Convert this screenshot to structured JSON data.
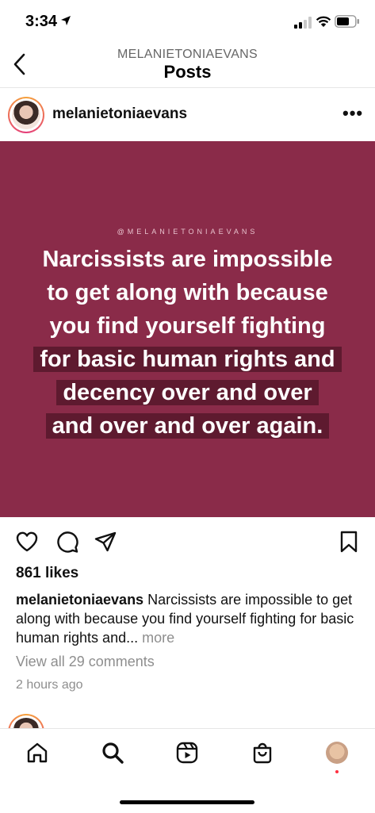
{
  "status_bar": {
    "time": "3:34",
    "icons": [
      "location-arrow-icon",
      "cellular-signal-icon",
      "wifi-icon",
      "battery-icon"
    ]
  },
  "header": {
    "account_name": "MELANIETONIAEVANS",
    "title": "Posts"
  },
  "post": {
    "username": "melanietoniaevans",
    "image": {
      "background_color": "#8a2b49",
      "watermark": "@MELANIETONIAEVANS",
      "quote_lines": [
        "Narcissists are impossible",
        "to get along with because",
        "you find yourself fighting",
        "for basic human rights and",
        "decency over and over",
        "and over and over again."
      ]
    },
    "likes": "861 likes",
    "caption_username": "melanietoniaevans",
    "caption_text": "Narcissists are impossible to get along with because you find yourself fighting for basic human rights and...",
    "caption_more": "more",
    "view_comments": "View all 29 comments",
    "time_ago": "2 hours ago"
  },
  "tab_bar": {
    "items": [
      "home-icon",
      "search-icon",
      "reels-icon",
      "shop-icon",
      "profile-avatar"
    ],
    "notification_dot_color": "#ff3040"
  }
}
